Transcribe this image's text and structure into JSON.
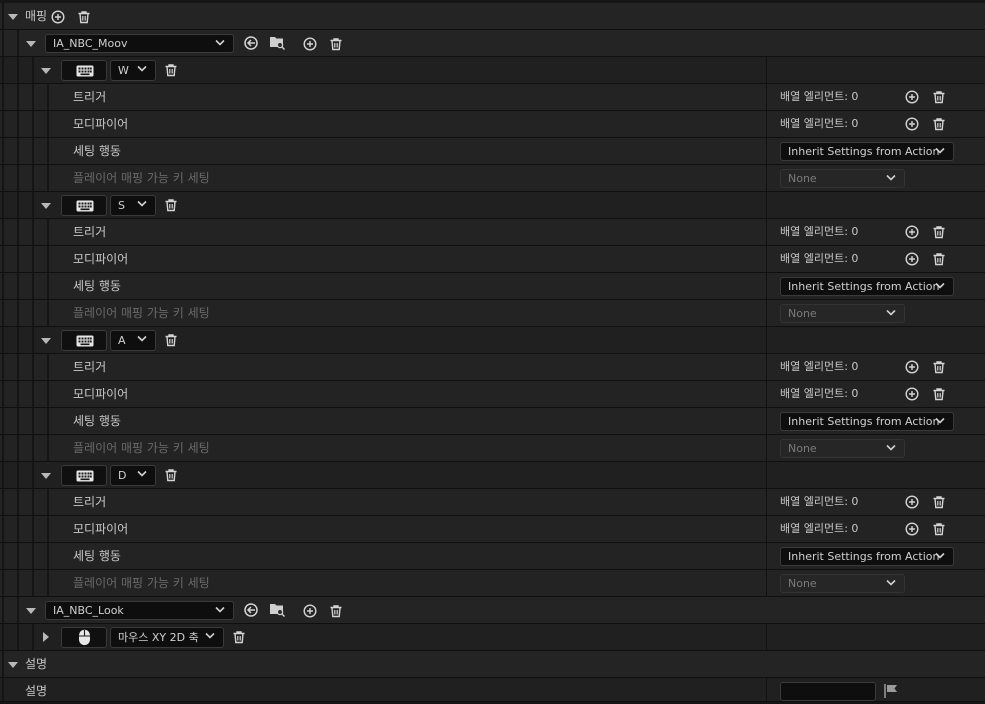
{
  "mappings": {
    "label": "매핑",
    "actions": [
      {
        "name": "IA_NBC_Moov",
        "keys": [
          {
            "key": "W",
            "device": "keyboard-icon",
            "rows": [
              {
                "label": "트리거",
                "value": "배열 엘리먼트: 0"
              },
              {
                "label": "모디파이어",
                "value": "배열 엘리먼트: 0"
              },
              {
                "label": "세팅 행동",
                "value": "Inherit Settings from Action"
              },
              {
                "label": "플레이어 매핑 가능 키 세팅",
                "value": "None"
              }
            ]
          },
          {
            "key": "S",
            "device": "keyboard-icon",
            "rows": [
              {
                "label": "트리거",
                "value": "배열 엘리먼트: 0"
              },
              {
                "label": "모디파이어",
                "value": "배열 엘리먼트: 0"
              },
              {
                "label": "세팅 행동",
                "value": "Inherit Settings from Action"
              },
              {
                "label": "플레이어 매핑 가능 키 세팅",
                "value": "None"
              }
            ]
          },
          {
            "key": "A",
            "device": "keyboard-icon",
            "rows": [
              {
                "label": "트리거",
                "value": "배열 엘리먼트: 0"
              },
              {
                "label": "모디파이어",
                "value": "배열 엘리먼트: 0"
              },
              {
                "label": "세팅 행동",
                "value": "Inherit Settings from Action"
              },
              {
                "label": "플레이어 매핑 가능 키 세팅",
                "value": "None"
              }
            ]
          },
          {
            "key": "D",
            "device": "keyboard-icon",
            "rows": [
              {
                "label": "트리거",
                "value": "배열 엘리먼트: 0"
              },
              {
                "label": "모디파이어",
                "value": "배열 엘리먼트: 0"
              },
              {
                "label": "세팅 행동",
                "value": "Inherit Settings from Action"
              },
              {
                "label": "플레이어 매핑 가능 키 세팅",
                "value": "None"
              }
            ]
          }
        ]
      },
      {
        "name": "IA_NBC_Look",
        "keys": [
          {
            "key": "마우스 XY 2D 축",
            "device": "mouse-icon"
          }
        ]
      }
    ]
  },
  "description": {
    "section_label": "설명",
    "field_label": "설명",
    "value": ""
  },
  "colors": {
    "background": "#151515",
    "row": "#242424",
    "input": "#0e0e0e",
    "text": "#c8c8c8",
    "dim_text": "#6a6a6a"
  }
}
